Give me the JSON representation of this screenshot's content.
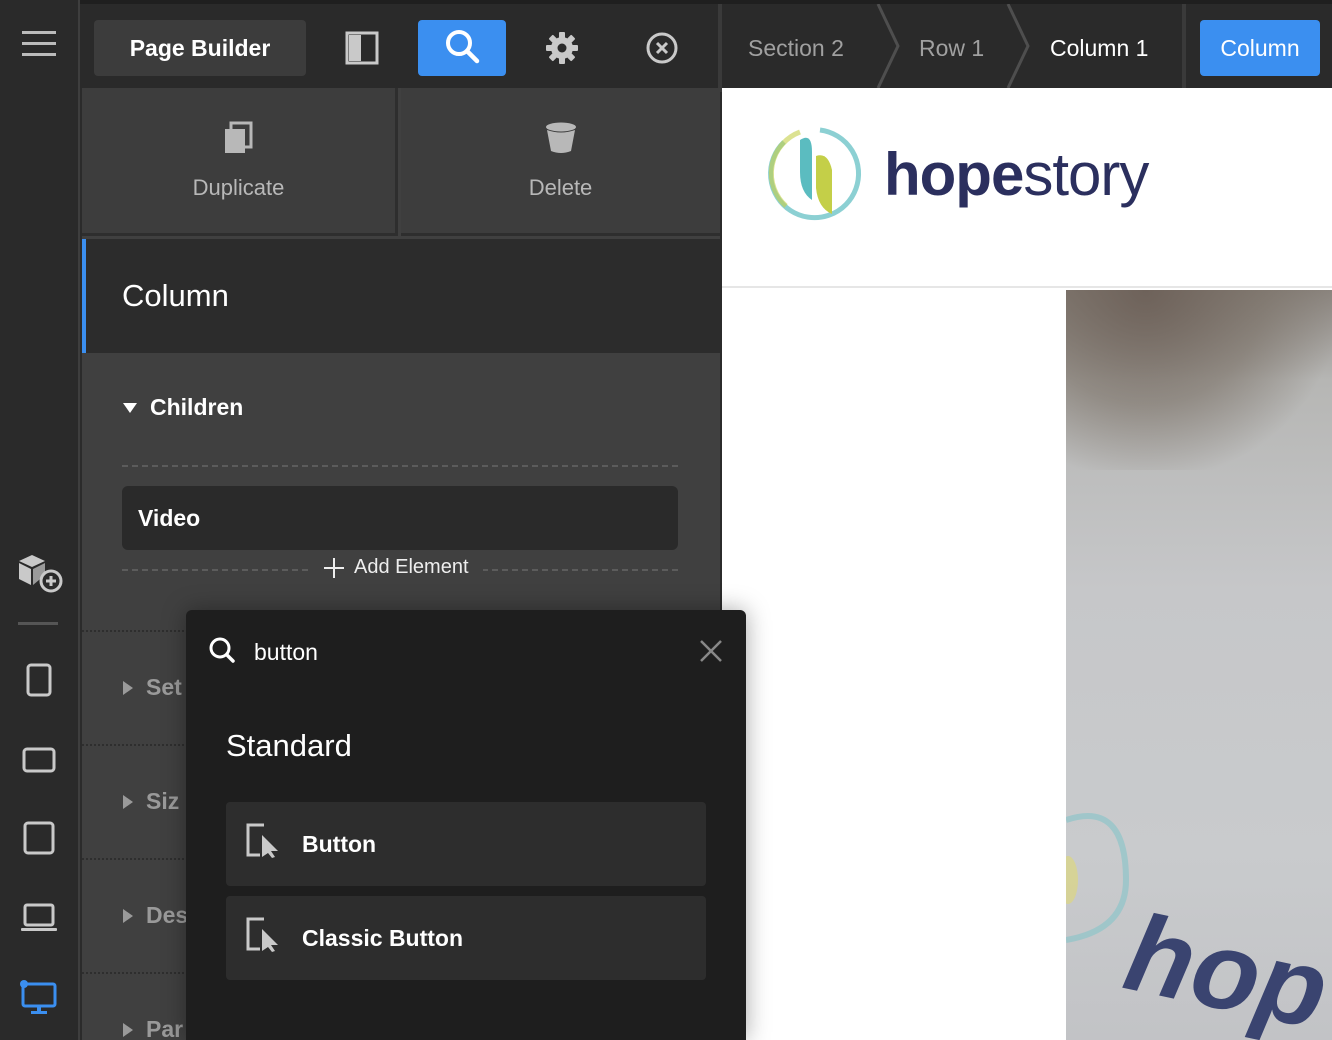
{
  "toolbar": {
    "page_builder_label": "Page Builder",
    "column_button_label": "Column"
  },
  "breadcrumb": [
    {
      "label": "Section 2"
    },
    {
      "label": "Row 1"
    },
    {
      "label": "Column 1"
    }
  ],
  "panel": {
    "duplicate_label": "Duplicate",
    "delete_label": "Delete",
    "title": "Column",
    "children_label": "Children",
    "children": [
      {
        "label": "Video"
      }
    ],
    "add_element_label": "Add Element",
    "sections": [
      {
        "label": "Set"
      },
      {
        "label": "Siz"
      },
      {
        "label": "Des"
      },
      {
        "label": "Par"
      }
    ]
  },
  "search_popup": {
    "query": "button",
    "category": "Standard",
    "results": [
      {
        "label": "Button"
      },
      {
        "label": "Classic Button"
      }
    ]
  },
  "canvas": {
    "logo_bold": "hope",
    "logo_light": "story",
    "photo_text": "hop"
  },
  "colors": {
    "accent": "#3b8ff0",
    "panel_bg": "#404040",
    "popup_bg": "#1e1e1e",
    "logo_navy": "#2b2f5e",
    "logo_teal": "#5bbcc0",
    "logo_lime": "#c4cf48"
  },
  "icons": {
    "rail": [
      "hamburger-menu-icon",
      "add-block-icon",
      "phone-portrait-icon",
      "phone-landscape-icon",
      "tablet-icon",
      "laptop-icon",
      "desktop-icon"
    ],
    "toolbar": [
      "panel-layout-icon",
      "search-icon",
      "gear-icon",
      "close-circle-icon"
    ]
  }
}
